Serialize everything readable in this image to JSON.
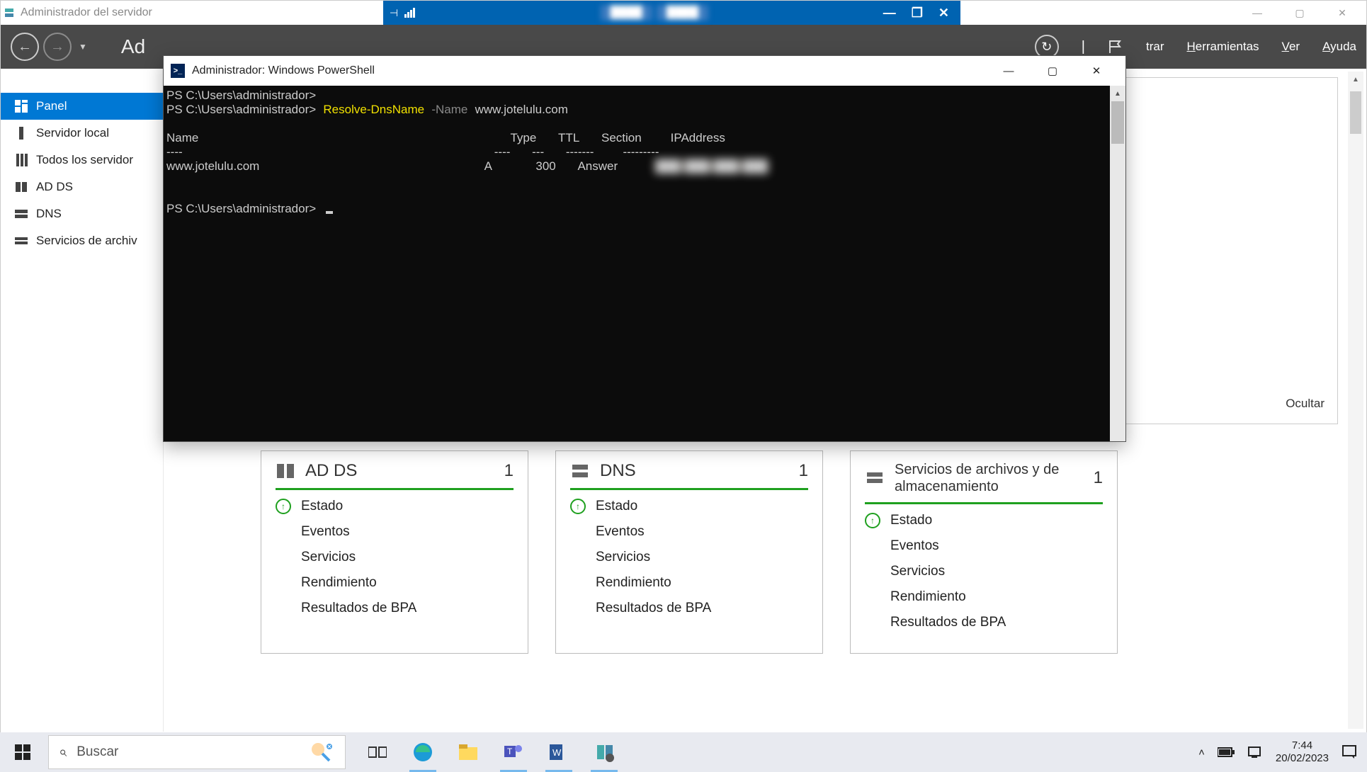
{
  "outer_window": {
    "title": "Administrador del servidor",
    "rdp_host_segments": [
      "████",
      "████"
    ]
  },
  "server_manager": {
    "breadcrumb_partial": "Ad",
    "menu": {
      "administrar_partial": "trar",
      "herramientas": "Herramientas",
      "ver": "Ver",
      "ayuda": "Ayuda"
    },
    "sidebar": [
      {
        "icon": "dashboard",
        "label": "Panel",
        "active": true
      },
      {
        "icon": "server",
        "label": "Servidor local",
        "active": false
      },
      {
        "icon": "servers",
        "label": "Todos los servidores",
        "active": false,
        "truncated": "Todos los servidor"
      },
      {
        "icon": "ad",
        "label": "AD DS",
        "active": false
      },
      {
        "icon": "dns",
        "label": "DNS",
        "active": false
      },
      {
        "icon": "files",
        "label": "Servicios de archivos y almacenamiento",
        "active": false,
        "truncated": "Servicios de archiv"
      }
    ],
    "ocultar": "Ocultar",
    "tiles": [
      {
        "icon": "ad",
        "title": "AD DS",
        "count": "1",
        "items": [
          "Estado",
          "Eventos",
          "Servicios",
          "Rendimiento",
          "Resultados de BPA"
        ]
      },
      {
        "icon": "dns",
        "title": "DNS",
        "count": "1",
        "items": [
          "Estado",
          "Eventos",
          "Servicios",
          "Rendimiento",
          "Resultados de BPA"
        ]
      },
      {
        "icon": "files",
        "title": "Servicios de archivos y de almacenamiento",
        "count": "1",
        "small": true,
        "items": [
          "Estado",
          "Eventos",
          "Servicios",
          "Rendimiento",
          "Resultados de BPA"
        ]
      }
    ]
  },
  "powershell": {
    "title": "Administrador: Windows PowerShell",
    "prompt": "PS C:\\Users\\administrador>",
    "command": {
      "cmdlet": "Resolve-DnsName",
      "param": "-Name",
      "arg": "www.jotelulu.com"
    },
    "headers": {
      "name": "Name",
      "type": "Type",
      "ttl": "TTL",
      "section": "Section",
      "ip": "IPAddress"
    },
    "dashes": {
      "name": "----",
      "type": "----",
      "ttl": "---",
      "section": "-------",
      "ip": "---------"
    },
    "row": {
      "name": "www.jotelulu.com",
      "type": "A",
      "ttl": "300",
      "section": "Answer",
      "ip": "███.███.███.███"
    }
  },
  "taskbar": {
    "search_placeholder": "Buscar",
    "time": "7:44",
    "date": "20/02/2023"
  }
}
